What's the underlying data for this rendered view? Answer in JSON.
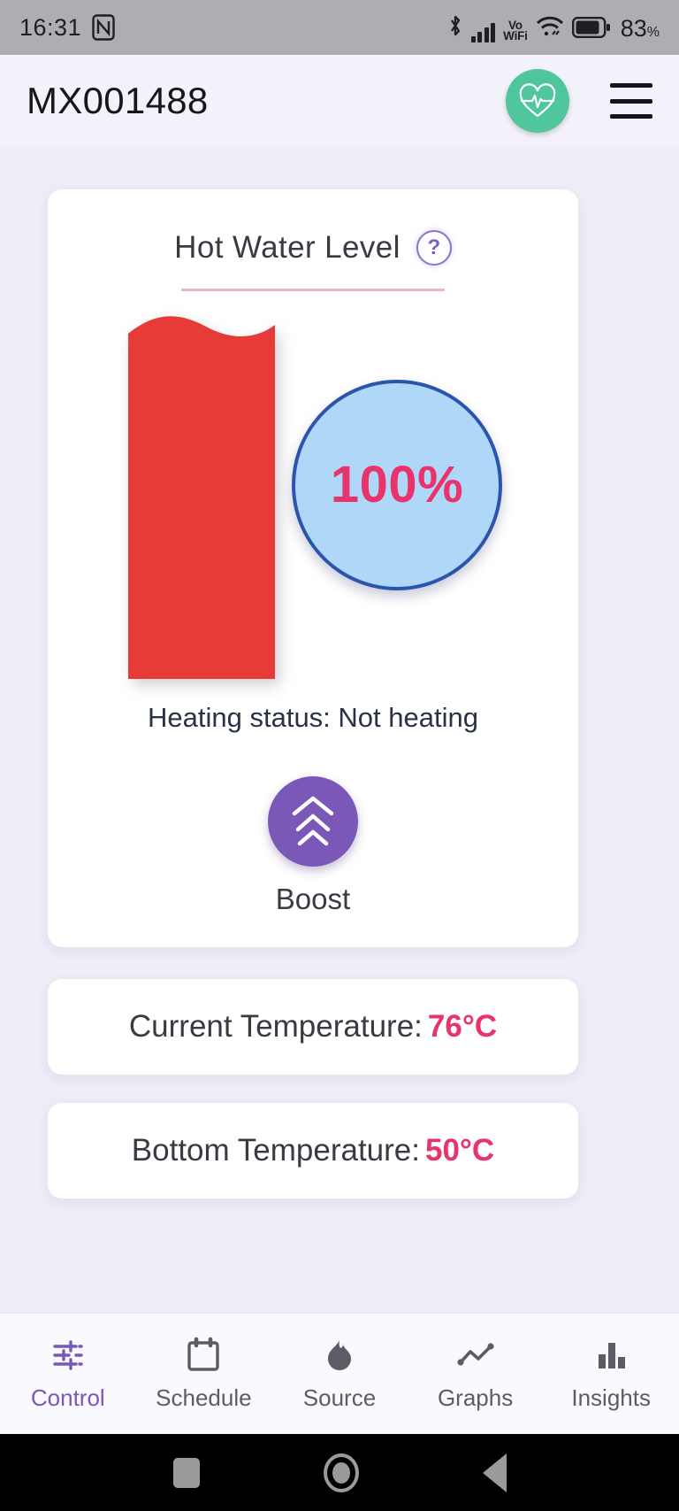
{
  "status_bar": {
    "time": "16:31",
    "nfc_icon": "nfc-icon",
    "bluetooth_icon": "bluetooth-icon",
    "signal_icon": "cellular-signal-icon",
    "vo_text": "Vo",
    "wifi_text": "WiFi",
    "wifi_icon": "wifi-icon",
    "battery_icon": "battery-icon",
    "battery_percent": "83",
    "battery_unit": "%"
  },
  "header": {
    "title": "MX001488",
    "heartbeat_button": "heartbeat-icon",
    "menu_button": "hamburger-menu-icon"
  },
  "level_card": {
    "title": "Hot Water Level",
    "help_glyph": "?",
    "percent_label": "100%",
    "percent_value": 100,
    "heating_status": "Heating status: Not heating",
    "boost_label": "Boost",
    "colors": {
      "tank_fill": "#E63B36",
      "bubble_fill": "#AFD8F8",
      "bubble_border": "#2B55AC",
      "percent_text": "#E8336B",
      "boost_button": "#7B57B8",
      "accent": "#7B57B8"
    }
  },
  "temperatures": [
    {
      "label": "Current Temperature:",
      "value": "76°C"
    },
    {
      "label": "Bottom Temperature:",
      "value": "50°C"
    }
  ],
  "bottom_nav": {
    "items": [
      {
        "label": "Control",
        "icon": "sliders-icon",
        "active": true
      },
      {
        "label": "Schedule",
        "icon": "calendar-icon",
        "active": false
      },
      {
        "label": "Source",
        "icon": "flame-icon",
        "active": false
      },
      {
        "label": "Graphs",
        "icon": "line-chart-icon",
        "active": false
      },
      {
        "label": "Insights",
        "icon": "bar-chart-icon",
        "active": false
      }
    ]
  },
  "system_nav": {
    "recents": "recents-square-icon",
    "home": "home-circle-icon",
    "back": "back-triangle-icon"
  }
}
